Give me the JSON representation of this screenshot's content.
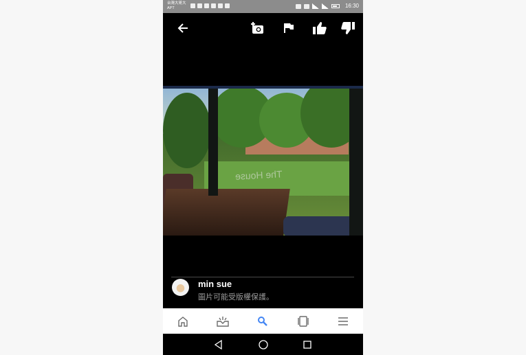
{
  "status_bar": {
    "carrier_line1": "台灣大哥大",
    "carrier_line2": "APT",
    "time": "16:30"
  },
  "top_bar": {
    "back_icon": "arrow-left-icon",
    "add_photo_icon": "add-photo-icon",
    "flag_icon": "flag-icon",
    "like_icon": "thumb-up-icon",
    "dislike_icon": "thumb-down-icon"
  },
  "photo": {
    "watermark": "The House"
  },
  "author": {
    "name": "min sue",
    "notice": "圖片可能受版權保護。"
  },
  "bottom_nav": {
    "items": [
      {
        "icon": "home-icon"
      },
      {
        "icon": "updates-icon"
      },
      {
        "icon": "search-icon",
        "active": true
      },
      {
        "icon": "tabs-icon"
      },
      {
        "icon": "menu-icon"
      }
    ],
    "active_color": "#4285f4",
    "inactive_color": "#6b6b6b"
  },
  "system_nav": {
    "back_icon": "triangle-back-icon",
    "home_icon": "circle-home-icon",
    "recents_icon": "square-recents-icon"
  }
}
